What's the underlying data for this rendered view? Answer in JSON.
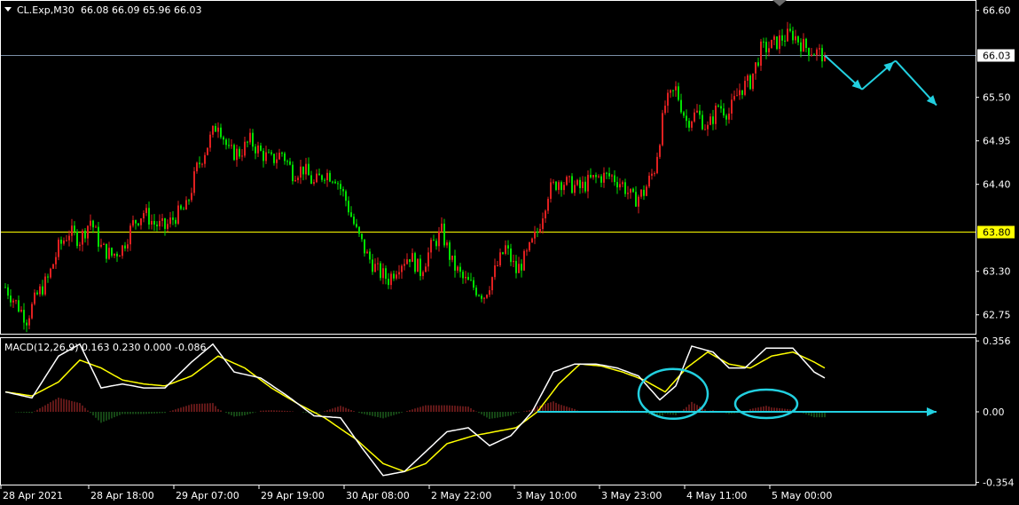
{
  "price_panel": {
    "symbol_label": "CL.Exp,M30",
    "ohlc_text": "66.08 66.09 65.96 66.03",
    "current_price_label": "66.03",
    "level_label": "63.80",
    "colors": {
      "bull": "#e02020",
      "bear": "#00e000",
      "current_line": "#7a8ea6",
      "level_line": "#ffff00",
      "level_label_bg": "#ffff00",
      "arrow": "#22d0e0"
    }
  },
  "macd_panel": {
    "label": "MACD(12,26,9) 0.163 0.230 0.000 -0.086",
    "colors": {
      "main": "#ffffff",
      "signal": "#ffff00",
      "hist_pos": "#c03030",
      "hist_neg": "#2a8a2a",
      "annotation": "#22d0e0"
    }
  },
  "chart_data": [
    {
      "type": "candlestick",
      "ylim": [
        62.5,
        66.72
      ],
      "y_ticks": [
        "66.60",
        "65.50",
        "64.95",
        "64.40",
        "63.30",
        "62.75"
      ],
      "current_price": 66.03,
      "level": 63.8,
      "x_tick_labels": [
        "28 Apr 2021",
        "28 Apr 18:00",
        "29 Apr 07:00",
        "29 Apr 19:00",
        "30 Apr 08:00",
        "2 May 22:00",
        "3 May 10:00",
        "3 May 23:00",
        "4 May 11:00",
        "5 May 00:00"
      ],
      "anchors": [
        [
          0,
          63.1
        ],
        [
          4,
          62.9
        ],
        [
          8,
          62.7
        ],
        [
          12,
          63.0
        ],
        [
          16,
          63.2
        ],
        [
          20,
          63.6
        ],
        [
          24,
          63.8
        ],
        [
          28,
          63.7
        ],
        [
          32,
          63.95
        ],
        [
          36,
          63.6
        ],
        [
          40,
          63.5
        ],
        [
          44,
          63.6
        ],
        [
          48,
          63.9
        ],
        [
          52,
          64.05
        ],
        [
          56,
          63.9
        ],
        [
          60,
          63.85
        ],
        [
          64,
          64.0
        ],
        [
          68,
          64.1
        ],
        [
          72,
          64.6
        ],
        [
          76,
          64.9
        ],
        [
          80,
          65.2
        ],
        [
          84,
          64.8
        ],
        [
          88,
          64.8
        ],
        [
          92,
          64.95
        ],
        [
          96,
          64.8
        ],
        [
          100,
          64.7
        ],
        [
          104,
          64.8
        ],
        [
          108,
          64.55
        ],
        [
          112,
          64.6
        ],
        [
          116,
          64.4
        ],
        [
          120,
          64.55
        ],
        [
          124,
          64.5
        ],
        [
          128,
          64.2
        ],
        [
          132,
          63.8
        ],
        [
          136,
          63.5
        ],
        [
          140,
          63.3
        ],
        [
          144,
          63.2
        ],
        [
          148,
          63.4
        ],
        [
          152,
          63.5
        ],
        [
          156,
          63.3
        ],
        [
          160,
          63.6
        ],
        [
          164,
          63.8
        ],
        [
          168,
          63.4
        ],
        [
          172,
          63.2
        ],
        [
          176,
          63.1
        ],
        [
          180,
          63.0
        ],
        [
          184,
          63.3
        ],
        [
          188,
          63.6
        ],
        [
          192,
          63.3
        ],
        [
          196,
          63.5
        ],
        [
          200,
          63.8
        ],
        [
          204,
          64.3
        ],
        [
          208,
          64.45
        ],
        [
          212,
          64.4
        ],
        [
          216,
          64.35
        ],
        [
          220,
          64.45
        ],
        [
          224,
          64.5
        ],
        [
          228,
          64.5
        ],
        [
          232,
          64.4
        ],
        [
          236,
          64.2
        ],
        [
          240,
          64.3
        ],
        [
          244,
          64.6
        ],
        [
          248,
          65.4
        ],
        [
          252,
          65.6
        ],
        [
          256,
          65.2
        ],
        [
          260,
          65.3
        ],
        [
          264,
          65.1
        ],
        [
          268,
          65.4
        ],
        [
          272,
          65.3
        ],
        [
          276,
          65.6
        ],
        [
          280,
          65.7
        ],
        [
          284,
          66.1
        ],
        [
          288,
          66.15
        ],
        [
          292,
          66.25
        ],
        [
          296,
          66.3
        ],
        [
          300,
          66.15
        ],
        [
          304,
          66.08
        ],
        [
          308,
          66.03
        ]
      ],
      "projection": [
        [
          308,
          66.03
        ],
        [
          322,
          65.6
        ],
        [
          334,
          65.95
        ],
        [
          350,
          65.4
        ]
      ]
    },
    {
      "type": "macd",
      "parameters": [
        12,
        26,
        9
      ],
      "ylim": [
        -0.37,
        0.37
      ],
      "y_ticks": [
        "0.356",
        "0.00",
        "-0.354"
      ],
      "main_anchors": [
        [
          0,
          0.1
        ],
        [
          10,
          0.07
        ],
        [
          20,
          0.28
        ],
        [
          28,
          0.34
        ],
        [
          36,
          0.12
        ],
        [
          44,
          0.14
        ],
        [
          52,
          0.12
        ],
        [
          60,
          0.12
        ],
        [
          70,
          0.25
        ],
        [
          78,
          0.34
        ],
        [
          86,
          0.2
        ],
        [
          96,
          0.17
        ],
        [
          106,
          0.08
        ],
        [
          116,
          -0.02
        ],
        [
          126,
          -0.03
        ],
        [
          134,
          -0.18
        ],
        [
          142,
          -0.32
        ],
        [
          150,
          -0.3
        ],
        [
          158,
          -0.2
        ],
        [
          166,
          -0.1
        ],
        [
          174,
          -0.08
        ],
        [
          182,
          -0.17
        ],
        [
          190,
          -0.12
        ],
        [
          198,
          0.0
        ],
        [
          206,
          0.2
        ],
        [
          214,
          0.24
        ],
        [
          222,
          0.24
        ],
        [
          230,
          0.22
        ],
        [
          238,
          0.18
        ],
        [
          246,
          0.06
        ],
        [
          252,
          0.13
        ],
        [
          258,
          0.33
        ],
        [
          266,
          0.3
        ],
        [
          272,
          0.22
        ],
        [
          278,
          0.22
        ],
        [
          286,
          0.32
        ],
        [
          296,
          0.32
        ],
        [
          304,
          0.2
        ],
        [
          308,
          0.17
        ]
      ],
      "signal_anchors": [
        [
          0,
          0.1
        ],
        [
          10,
          0.08
        ],
        [
          20,
          0.15
        ],
        [
          28,
          0.26
        ],
        [
          36,
          0.22
        ],
        [
          44,
          0.16
        ],
        [
          52,
          0.14
        ],
        [
          60,
          0.13
        ],
        [
          70,
          0.18
        ],
        [
          80,
          0.28
        ],
        [
          90,
          0.22
        ],
        [
          100,
          0.12
        ],
        [
          110,
          0.04
        ],
        [
          120,
          -0.03
        ],
        [
          132,
          -0.14
        ],
        [
          142,
          -0.26
        ],
        [
          150,
          -0.3
        ],
        [
          158,
          -0.26
        ],
        [
          166,
          -0.16
        ],
        [
          176,
          -0.12
        ],
        [
          184,
          -0.1
        ],
        [
          192,
          -0.08
        ],
        [
          200,
          0.0
        ],
        [
          208,
          0.14
        ],
        [
          216,
          0.24
        ],
        [
          224,
          0.23
        ],
        [
          232,
          0.2
        ],
        [
          240,
          0.16
        ],
        [
          248,
          0.1
        ],
        [
          256,
          0.22
        ],
        [
          264,
          0.3
        ],
        [
          272,
          0.24
        ],
        [
          280,
          0.22
        ],
        [
          288,
          0.28
        ],
        [
          296,
          0.3
        ],
        [
          304,
          0.25
        ],
        [
          308,
          0.22
        ]
      ],
      "zero_projection_end_index": 350
    }
  ]
}
